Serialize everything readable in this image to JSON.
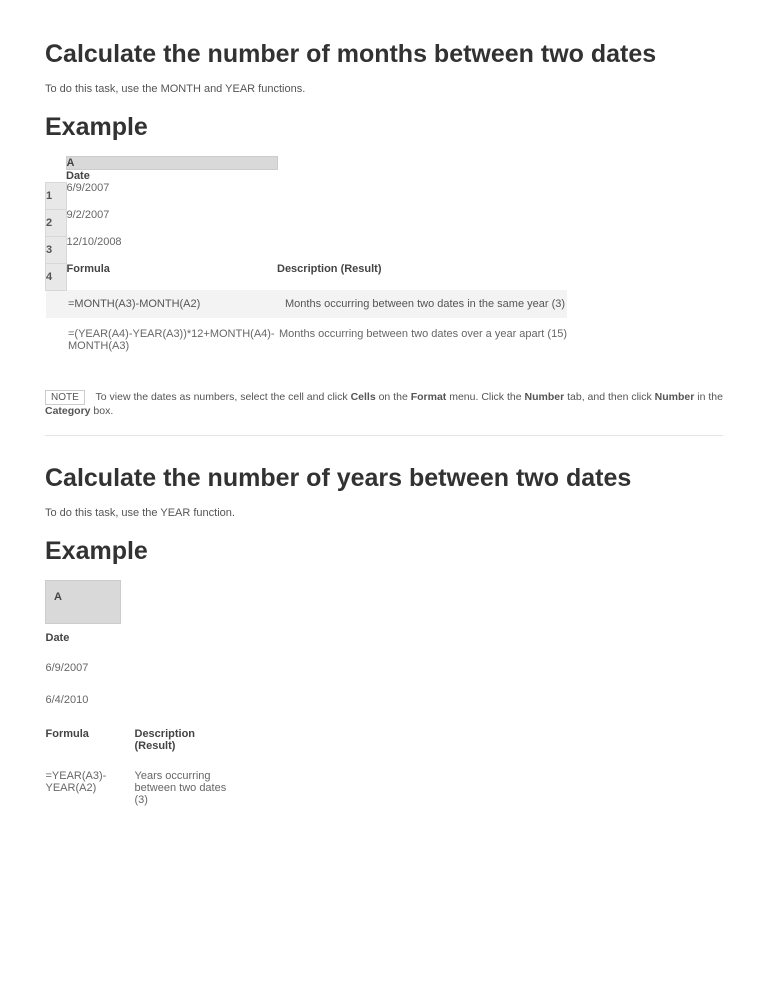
{
  "section1": {
    "heading": "Calculate the number of months between two dates",
    "intro": "To do this task, use the MONTH and YEAR functions.",
    "example_label": "Example",
    "col_a": "A",
    "date_header": "Date",
    "rows": {
      "r1": "1",
      "r2": "2",
      "r3": "3",
      "r4": "4",
      "d1": "6/9/2007",
      "d2": "9/2/2007",
      "d3": "12/10/2008"
    },
    "formula_header": "Formula",
    "desc_header": "Description (Result)",
    "f1": "=MONTH(A3)-MONTH(A2)",
    "f1_desc": "Months occurring between two dates in the same year (3)",
    "f2": "=(YEAR(A4)-YEAR(A3))*12+MONTH(A4)-MONTH(A3)",
    "f2_desc": "Months occurring between two dates over a year apart (15)"
  },
  "note": {
    "badge": "NOTE",
    "t1": "To view the dates as numbers, select the cell and click ",
    "b1": "Cells",
    "t2": " on the ",
    "b2": "Format",
    "t3": " menu. Click the ",
    "b3": "Number",
    "t4": " tab, and then click ",
    "b4": "Number",
    "t5": " in the ",
    "b5": "Category",
    "t6": " box."
  },
  "section2": {
    "heading": "Calculate the number of years between two dates",
    "intro": "To do this task, use the YEAR function.",
    "example_label": "Example",
    "col_a": "A",
    "date_header": "Date",
    "d1": "6/9/2007",
    "d2": "6/4/2010",
    "formula_header": "Formula",
    "desc_header": "Description (Result)",
    "f1": "=YEAR(A3)-YEAR(A2)",
    "f1_desc": "Years occurring between two dates (3)"
  }
}
